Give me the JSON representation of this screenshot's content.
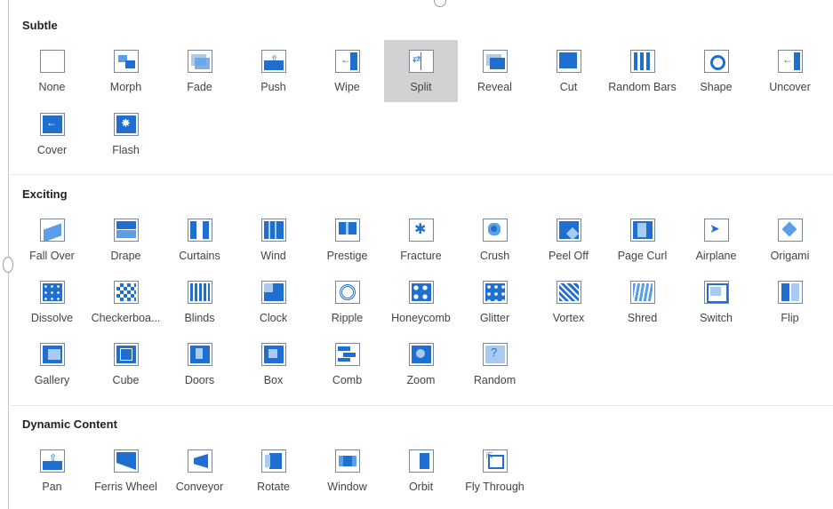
{
  "sections": [
    {
      "title": "Subtle",
      "items": [
        {
          "label": "None",
          "icon": "none-transition-icon"
        },
        {
          "label": "Morph",
          "icon": "morph-transition-icon"
        },
        {
          "label": "Fade",
          "icon": "fade-transition-icon"
        },
        {
          "label": "Push",
          "icon": "push-transition-icon"
        },
        {
          "label": "Wipe",
          "icon": "wipe-transition-icon"
        },
        {
          "label": "Split",
          "icon": "split-transition-icon",
          "selected": true
        },
        {
          "label": "Reveal",
          "icon": "reveal-transition-icon"
        },
        {
          "label": "Cut",
          "icon": "cut-transition-icon"
        },
        {
          "label": "Random Bars",
          "icon": "random-bars-transition-icon"
        },
        {
          "label": "Shape",
          "icon": "shape-transition-icon"
        },
        {
          "label": "Uncover",
          "icon": "uncover-transition-icon"
        },
        {
          "label": "Cover",
          "icon": "cover-transition-icon"
        },
        {
          "label": "Flash",
          "icon": "flash-transition-icon"
        }
      ]
    },
    {
      "title": "Exciting",
      "items": [
        {
          "label": "Fall Over",
          "icon": "fall-over-transition-icon"
        },
        {
          "label": "Drape",
          "icon": "drape-transition-icon"
        },
        {
          "label": "Curtains",
          "icon": "curtains-transition-icon"
        },
        {
          "label": "Wind",
          "icon": "wind-transition-icon"
        },
        {
          "label": "Prestige",
          "icon": "prestige-transition-icon"
        },
        {
          "label": "Fracture",
          "icon": "fracture-transition-icon"
        },
        {
          "label": "Crush",
          "icon": "crush-transition-icon"
        },
        {
          "label": "Peel Off",
          "icon": "peel-off-transition-icon"
        },
        {
          "label": "Page Curl",
          "icon": "page-curl-transition-icon"
        },
        {
          "label": "Airplane",
          "icon": "airplane-transition-icon"
        },
        {
          "label": "Origami",
          "icon": "origami-transition-icon"
        },
        {
          "label": "Dissolve",
          "icon": "dissolve-transition-icon"
        },
        {
          "label": "Checkerboa...",
          "icon": "checkerboard-transition-icon"
        },
        {
          "label": "Blinds",
          "icon": "blinds-transition-icon"
        },
        {
          "label": "Clock",
          "icon": "clock-transition-icon"
        },
        {
          "label": "Ripple",
          "icon": "ripple-transition-icon"
        },
        {
          "label": "Honeycomb",
          "icon": "honeycomb-transition-icon"
        },
        {
          "label": "Glitter",
          "icon": "glitter-transition-icon"
        },
        {
          "label": "Vortex",
          "icon": "vortex-transition-icon"
        },
        {
          "label": "Shred",
          "icon": "shred-transition-icon"
        },
        {
          "label": "Switch",
          "icon": "switch-transition-icon"
        },
        {
          "label": "Flip",
          "icon": "flip-transition-icon"
        },
        {
          "label": "Gallery",
          "icon": "gallery-transition-icon"
        },
        {
          "label": "Cube",
          "icon": "cube-transition-icon"
        },
        {
          "label": "Doors",
          "icon": "doors-transition-icon"
        },
        {
          "label": "Box",
          "icon": "box-transition-icon"
        },
        {
          "label": "Comb",
          "icon": "comb-transition-icon"
        },
        {
          "label": "Zoom",
          "icon": "zoom-transition-icon"
        },
        {
          "label": "Random",
          "icon": "random-transition-icon"
        }
      ]
    },
    {
      "title": "Dynamic Content",
      "items": [
        {
          "label": "Pan",
          "icon": "pan-transition-icon"
        },
        {
          "label": "Ferris Wheel",
          "icon": "ferris-wheel-transition-icon"
        },
        {
          "label": "Conveyor",
          "icon": "conveyor-transition-icon"
        },
        {
          "label": "Rotate",
          "icon": "rotate-transition-icon"
        },
        {
          "label": "Window",
          "icon": "window-transition-icon"
        },
        {
          "label": "Orbit",
          "icon": "orbit-transition-icon"
        },
        {
          "label": "Fly Through",
          "icon": "fly-through-transition-icon"
        }
      ]
    }
  ],
  "colors": {
    "accent": "#1f6fd1",
    "accent_light": "#a9cbf2",
    "selected_bg": "#d2d2d2"
  }
}
